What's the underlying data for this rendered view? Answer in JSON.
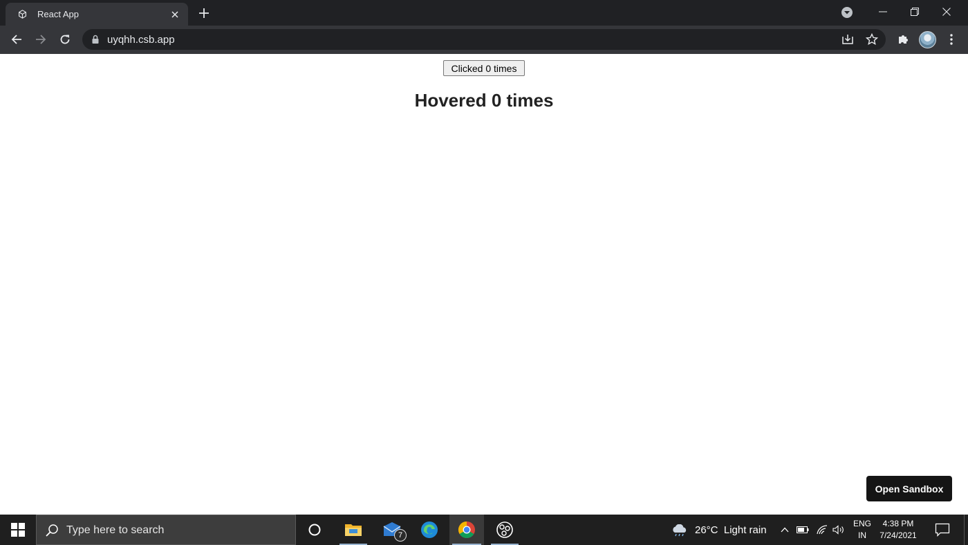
{
  "browser": {
    "tab": {
      "title": "React App",
      "favicon": "react-cube-icon"
    },
    "new_tab_icon": "plus-icon",
    "tab_search_icon": "chevron-down-circle-icon",
    "window_controls": [
      "minimize-icon",
      "restore-icon",
      "close-icon"
    ],
    "toolbar": {
      "back_icon": "arrow-left-icon",
      "forward_icon": "arrow-right-icon",
      "reload_icon": "reload-icon",
      "url": "uyqhh.csb.app",
      "install_icon": "install-app-icon",
      "bookmark_icon": "star-icon",
      "extensions_icon": "puzzle-icon",
      "menu_icon": "kebab-menu-icon"
    }
  },
  "page": {
    "click_button_label": "Clicked 0 times",
    "hover_heading": "Hovered 0 times",
    "open_sandbox_label": "Open Sandbox"
  },
  "taskbar": {
    "search_placeholder": "Type here to search",
    "mail_badge": "7",
    "weather": {
      "temp": "26°C",
      "condition": "Light rain"
    },
    "language": {
      "line1": "ENG",
      "line2": "IN"
    },
    "clock": {
      "time": "4:38 PM",
      "date": "7/24/2021"
    },
    "colors": {
      "accent": "#9ab5d1",
      "taskbar": "#1f1f1f"
    }
  }
}
